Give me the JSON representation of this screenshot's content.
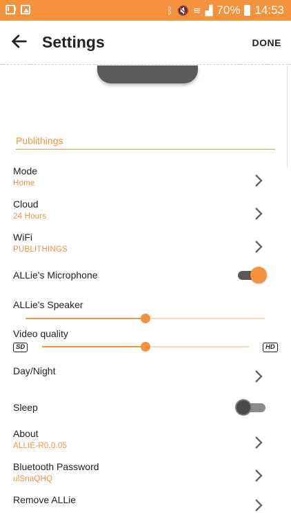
{
  "status_bar": {
    "left_icons": [
      "mail-icon",
      "image-icon"
    ],
    "right_icons": [
      "bluetooth-icon",
      "mute-icon",
      "wifi-icon",
      "signal-icon"
    ],
    "battery": "70%",
    "time": "14:53",
    "color": "#f5923e"
  },
  "app_bar": {
    "back_icon": "back-arrow-icon",
    "title": "Settings",
    "done_label": "DONE"
  },
  "section": {
    "title": "Publithings"
  },
  "items": {
    "mode": {
      "label": "Mode",
      "value": "Home"
    },
    "cloud": {
      "label": "Cloud",
      "value": "24 Hours"
    },
    "wifi": {
      "label": "WiFi",
      "value": "PUBLITHINGS"
    },
    "microphone": {
      "label": "ALLie's Microphone",
      "enabled": true
    },
    "speaker": {
      "label": "ALLie's Speaker",
      "level": 0.5
    },
    "video_quality": {
      "label": "Video quality",
      "min_label": "SD",
      "max_label": "HD",
      "level": 0.5
    },
    "day_night": {
      "label": "Day/Night"
    },
    "sleep": {
      "label": "Sleep",
      "enabled": false
    },
    "about": {
      "label": "About",
      "value": "ALLIE-R0.0.05"
    },
    "bluetooth_password": {
      "label": "Bluetooth Password",
      "value": "ulSnaQHQ"
    },
    "remove": {
      "label": "Remove ALLie"
    }
  },
  "accent_color": "#f5923e"
}
